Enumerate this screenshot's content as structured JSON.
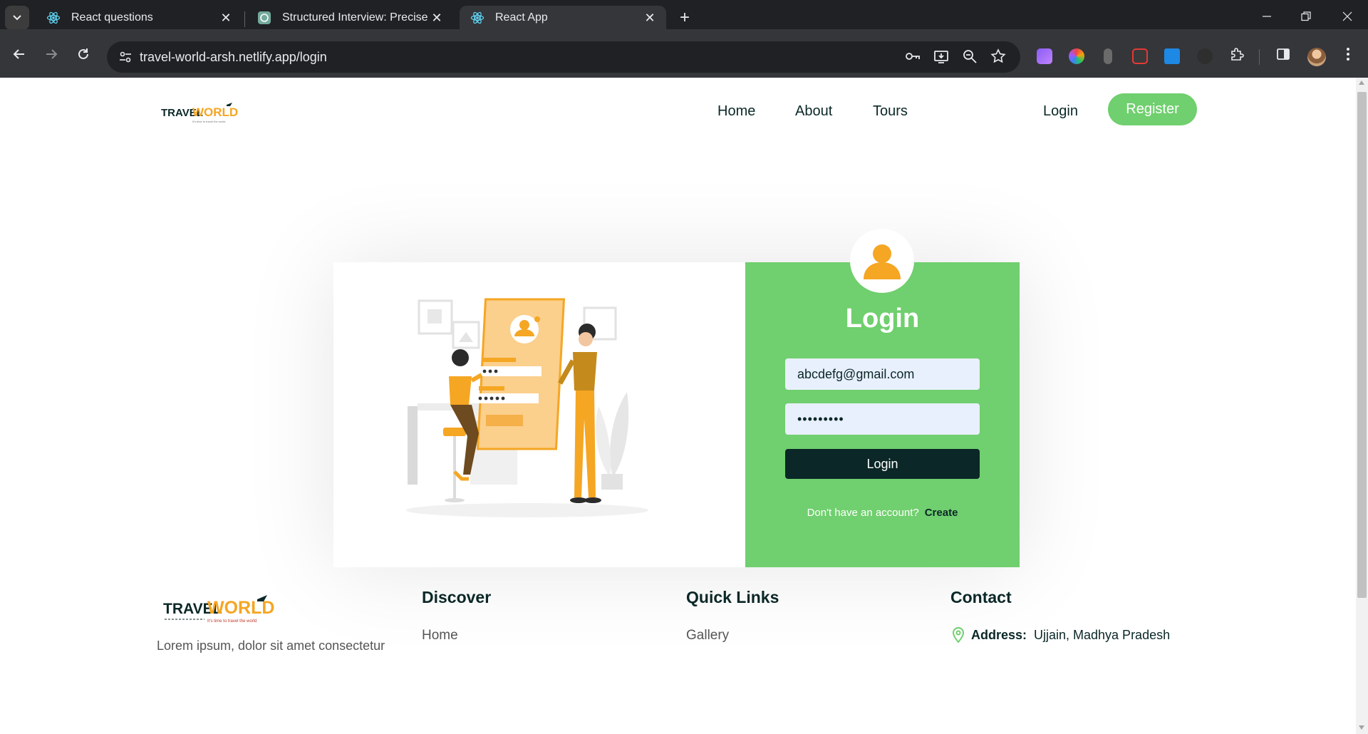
{
  "browser": {
    "tabs": [
      {
        "title": "React questions",
        "icon": "react-icon",
        "active": false
      },
      {
        "title": "Structured Interview: Precise Re",
        "icon": "chatgpt-icon",
        "active": false
      },
      {
        "title": "React App",
        "icon": "react-icon",
        "active": true
      }
    ],
    "url": "travel-world-arsh.netlify.app/login",
    "new_tab_glyph": "+",
    "close_glyph": "✕"
  },
  "header": {
    "logo": {
      "word1": "TRAVEL",
      "word2": "WORLD",
      "tagline": "It's time to travel the world"
    },
    "nav": [
      "Home",
      "About",
      "Tours"
    ],
    "login_label": "Login",
    "register_label": "Register",
    "accent_color": "#70cf6e"
  },
  "login_card": {
    "title": "Login",
    "email_value": "abcdefg@gmail.com",
    "password_value": "•••••••••",
    "submit_label": "Login",
    "prompt_text": "Don't have an account?",
    "create_label": "Create",
    "panel_color": "#70cf6e",
    "button_color": "#0b2727"
  },
  "footer": {
    "logo": {
      "word1": "TRAVEL",
      "word2": "WORLD",
      "tagline": "It's time to travel the world"
    },
    "description": "Lorem ipsum, dolor sit amet consectetur",
    "discover": {
      "heading": "Discover",
      "links": [
        "Home"
      ]
    },
    "quick_links": {
      "heading": "Quick Links",
      "links": [
        "Gallery"
      ]
    },
    "contact": {
      "heading": "Contact",
      "address_label": "Address:",
      "address_value": "Ujjain, Madhya Pradesh"
    }
  }
}
